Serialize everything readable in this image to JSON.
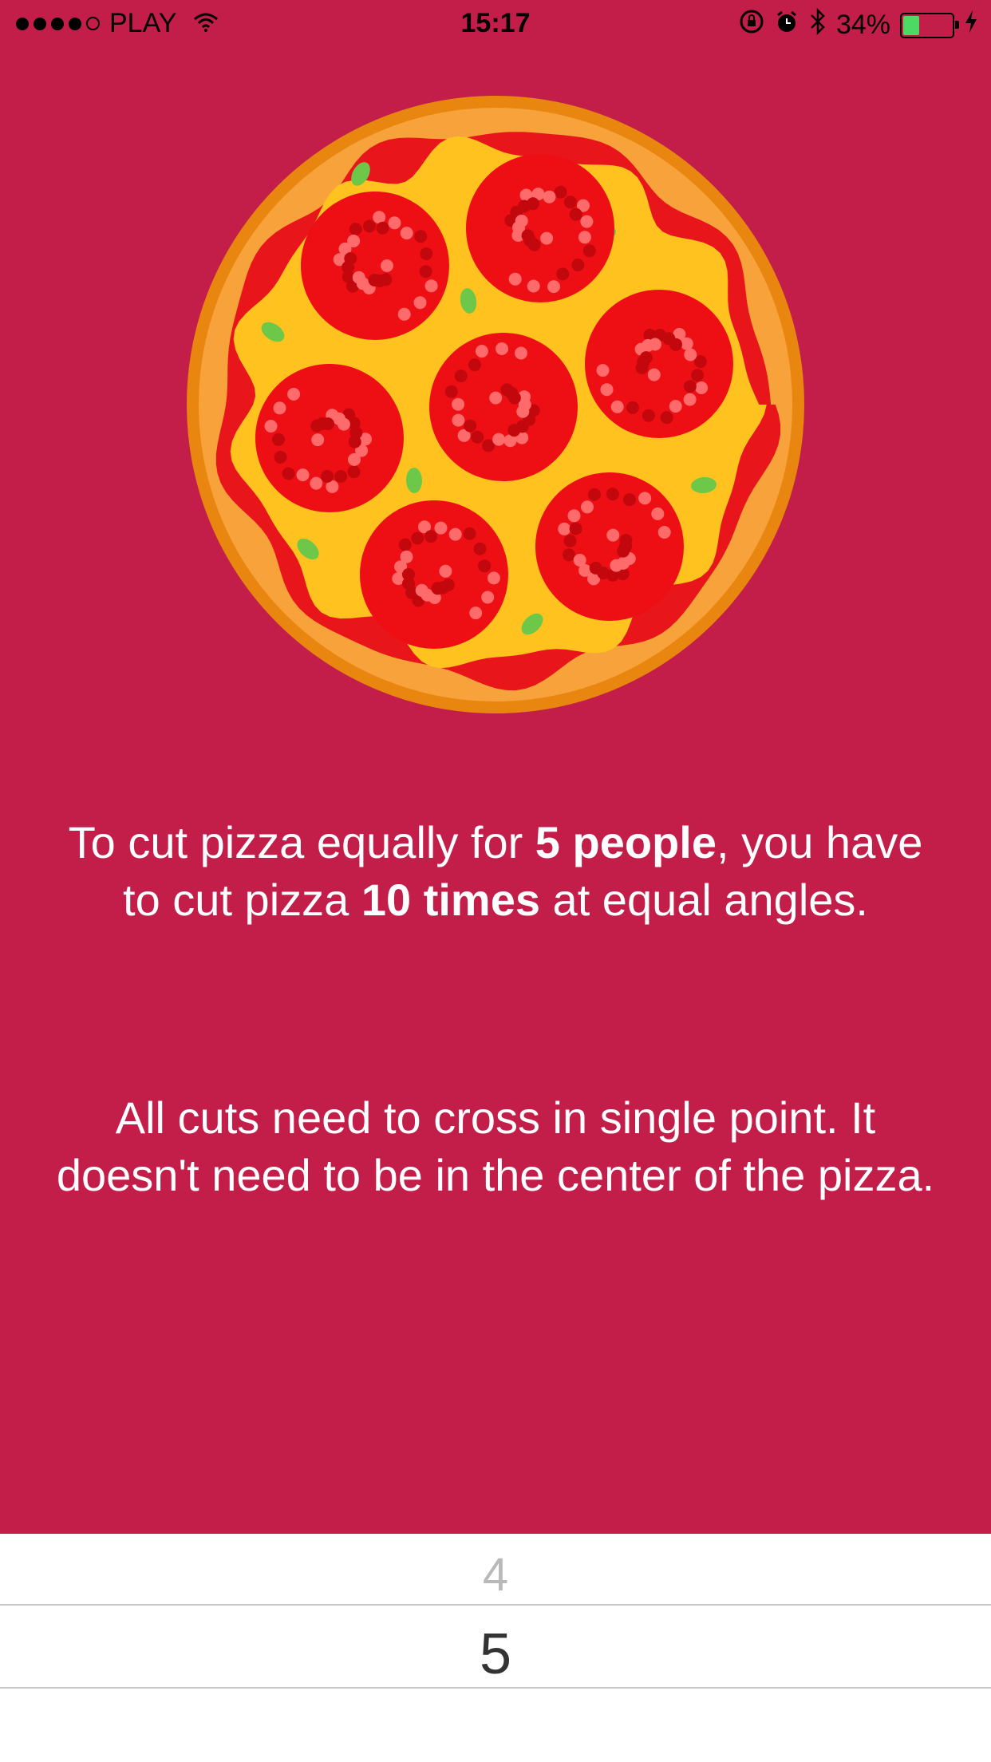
{
  "status_bar": {
    "carrier": "PLAY",
    "time": "15:17",
    "battery_percent": "34%",
    "battery_level": 0.34,
    "icons": [
      "signal-dots-icon",
      "wifi-icon",
      "rotation-lock-icon",
      "alarm-icon",
      "bluetooth-icon",
      "battery-icon",
      "charging-bolt-icon"
    ]
  },
  "hero": {
    "image": "pepperoni-pizza-illustration"
  },
  "message": {
    "line1_prefix": "To cut pizza equally for ",
    "people_bold": "5 people",
    "line1_mid": ", you have to cut pizza ",
    "cuts_bold": "10 times",
    "line1_suffix": " at equal angles.",
    "note": "All cuts need to cross in single point. It doesn't need to be in the center of the pizza."
  },
  "picker": {
    "previous_value": "4",
    "selected_value": "5"
  },
  "colors": {
    "background": "#c21e49",
    "crust": "#f39221",
    "cheese": "#ffc21f",
    "sauce": "#e8151b",
    "pepperoni": "#ee0f14",
    "basil": "#6dc84a"
  }
}
